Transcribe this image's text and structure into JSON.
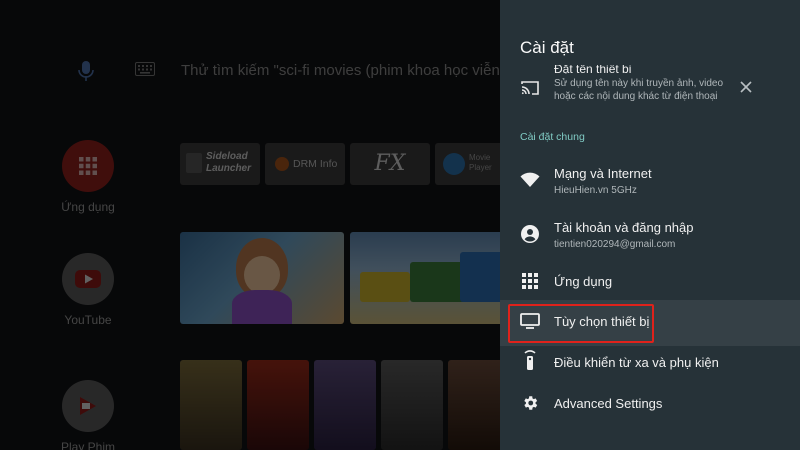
{
  "launcher": {
    "search_hint": "Thử tìm kiếm \"sci-fi movies (phim khoa học viễn tưởng)\"",
    "side_apps": [
      {
        "label": "Ứng dụng",
        "icon": "apps-grid-icon",
        "color": "#c62828"
      },
      {
        "label": "YouTube",
        "icon": "youtube-play-icon",
        "color": "#e0e0e0"
      },
      {
        "label": "Play Phim",
        "icon": "play-movies-icon",
        "color": "#e0e0e0"
      }
    ],
    "app_tiles": [
      {
        "label": "Sideload Launcher"
      },
      {
        "label": "DRM Info"
      },
      {
        "label": "FX"
      },
      {
        "label": "Movie Player"
      }
    ]
  },
  "settings": {
    "title": "Cài đặt",
    "device_name_row": {
      "title": "Đặt tên thiết bị",
      "subtitle": "Sử dụng tên này khi truyền ảnh, video hoặc các nội dung khác từ điện thoại",
      "icon": "cast-icon"
    },
    "section_general": "Cài đặt chung",
    "items": [
      {
        "title": "Mạng và Internet",
        "subtitle": "HieuHien.vn 5GHz",
        "icon": "wifi-icon"
      },
      {
        "title": "Tài khoản và đăng nhập",
        "subtitle": "tientien020294@gmail.com",
        "icon": "account-icon"
      },
      {
        "title": "Ứng dụng",
        "subtitle": "",
        "icon": "apps-grid-icon"
      },
      {
        "title": "Tùy chọn thiết bị",
        "subtitle": "",
        "icon": "tv-icon"
      },
      {
        "title": "Điều khiển từ xa và phụ kiện",
        "subtitle": "",
        "icon": "remote-icon"
      },
      {
        "title": "Advanced Settings",
        "subtitle": "",
        "icon": "gear-icon"
      }
    ]
  },
  "colors": {
    "panel_bg": "#263238",
    "accent": "#80cbc4",
    "highlight": "#e0221b"
  }
}
